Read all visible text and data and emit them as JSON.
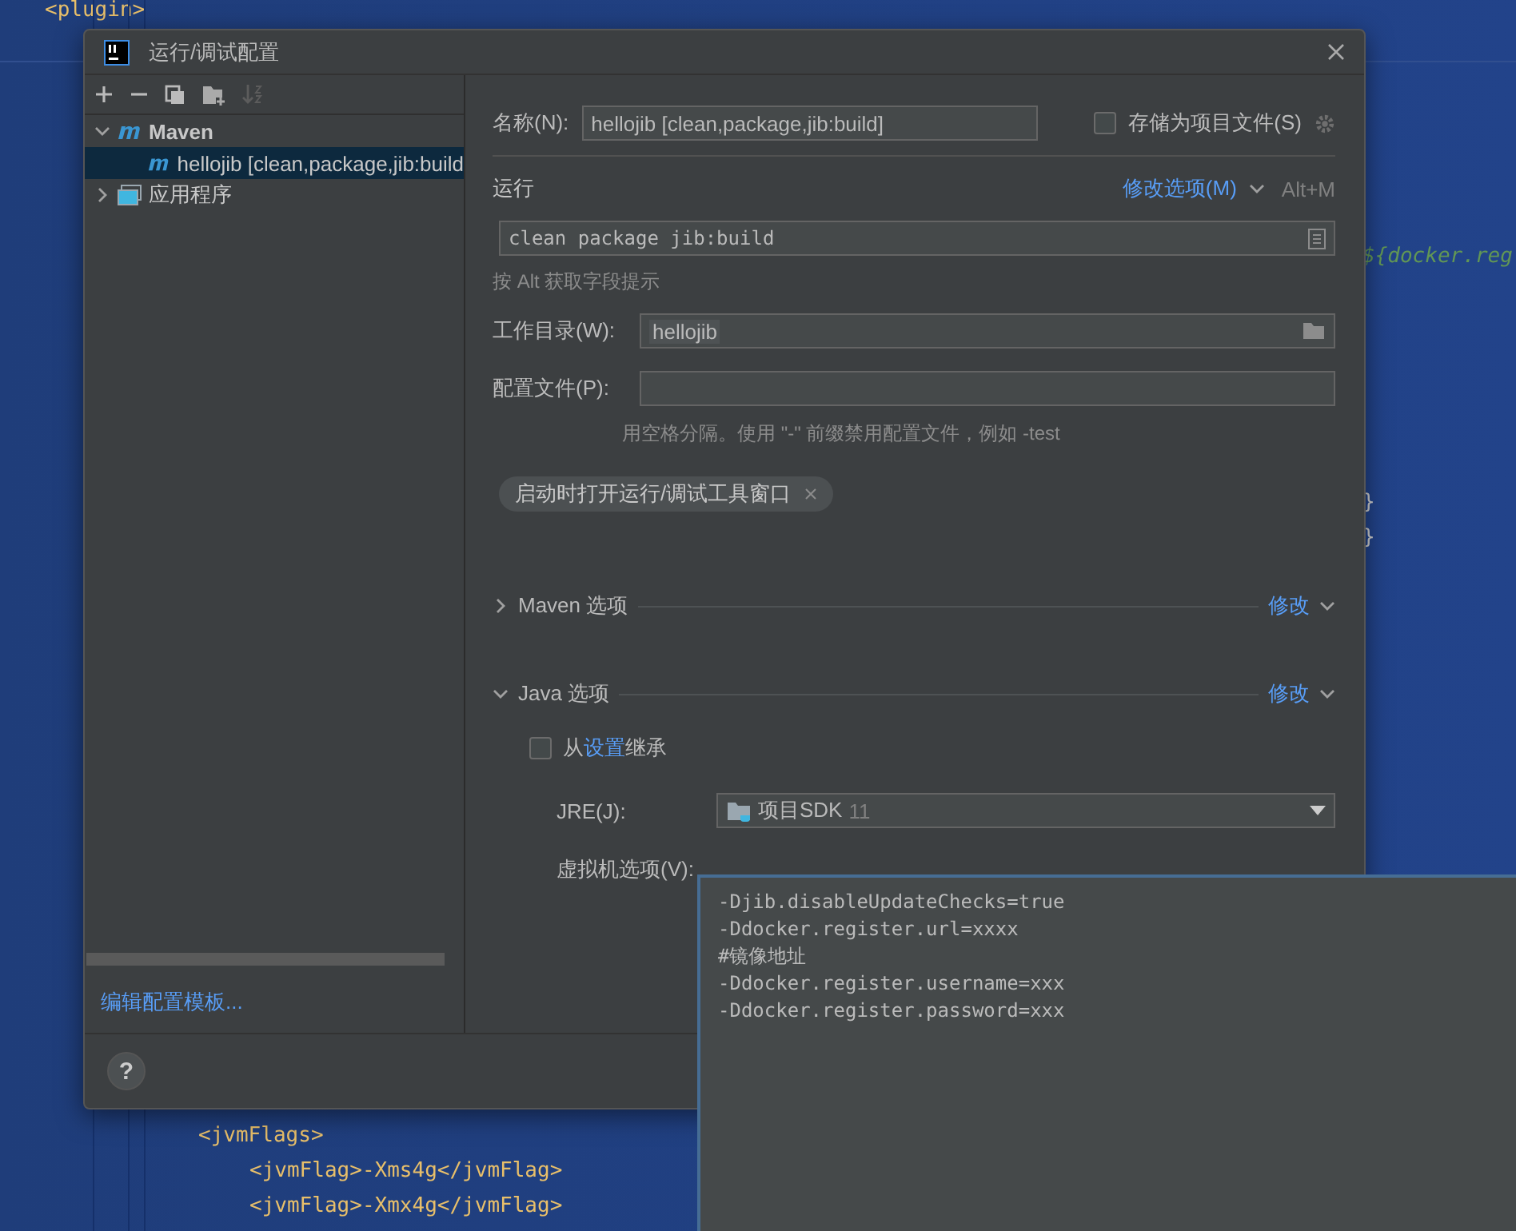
{
  "editor": {
    "lines": [
      {
        "text": "<plugin>",
        "kind": "tag"
      },
      {
        "text": "${docker.reg",
        "kind": "expr"
      },
      {
        "text": "}",
        "kind": "brace"
      },
      {
        "text": "}",
        "kind": "brace"
      },
      {
        "text": "<jvmFlags>",
        "kind": "tag"
      },
      {
        "text": "<jvmFlag>-Xms4g</jvmFlag>",
        "kind": "tag"
      },
      {
        "text": "<jvmFlag>-Xmx4g</jvmFlag>",
        "kind": "tag"
      }
    ]
  },
  "dialog": {
    "title": "运行/调试配置"
  },
  "tree": [
    {
      "label": "Maven",
      "kind": "maven",
      "expanded": true,
      "selected": false,
      "children": [
        {
          "label": "hellojib [clean,package,jib:build",
          "kind": "maven",
          "selected": true
        }
      ]
    },
    {
      "label": "应用程序",
      "kind": "app",
      "expanded": false,
      "selected": false
    }
  ],
  "templates_link": "编辑配置模板...",
  "help_button": "?",
  "name": {
    "label": "名称(N):",
    "value": "hellojib [clean,package,jib:build]"
  },
  "store_as_file": {
    "label": "存储为项目文件(S)",
    "checked": false
  },
  "run": {
    "heading": "运行",
    "modify": "修改选项(M)",
    "shortcut": "Alt+M",
    "command": "clean package jib:build",
    "hint": "按 Alt 获取字段提示"
  },
  "working_dir": {
    "label": "工作目录(W):",
    "value": "hellojib"
  },
  "profiles": {
    "label": "配置文件(P):",
    "hint": "用空格分隔。使用 \"-\" 前缀禁用配置文件，例如 -test"
  },
  "chips": [
    {
      "label": "启动时打开运行/调试工具窗口"
    }
  ],
  "sections": [
    {
      "title": "Maven 选项",
      "expanded": false,
      "modify": "修改"
    },
    {
      "title": "Java 选项",
      "expanded": true,
      "modify": "修改",
      "inherit": {
        "before": "从",
        "link": "设置",
        "after": "继承",
        "checked": false
      },
      "jre": {
        "label": "JRE(J):",
        "value": "项目SDK",
        "version": "11"
      },
      "vm_options": {
        "label": "虚拟机选项(V):",
        "lines": [
          "-Djib.disableUpdateChecks=true",
          "-Ddocker.register.url=xxxx",
          "#镜像地址",
          "-Ddocker.register.username=xxx",
          "-Ddocker.register.password=xxx"
        ]
      }
    }
  ]
}
